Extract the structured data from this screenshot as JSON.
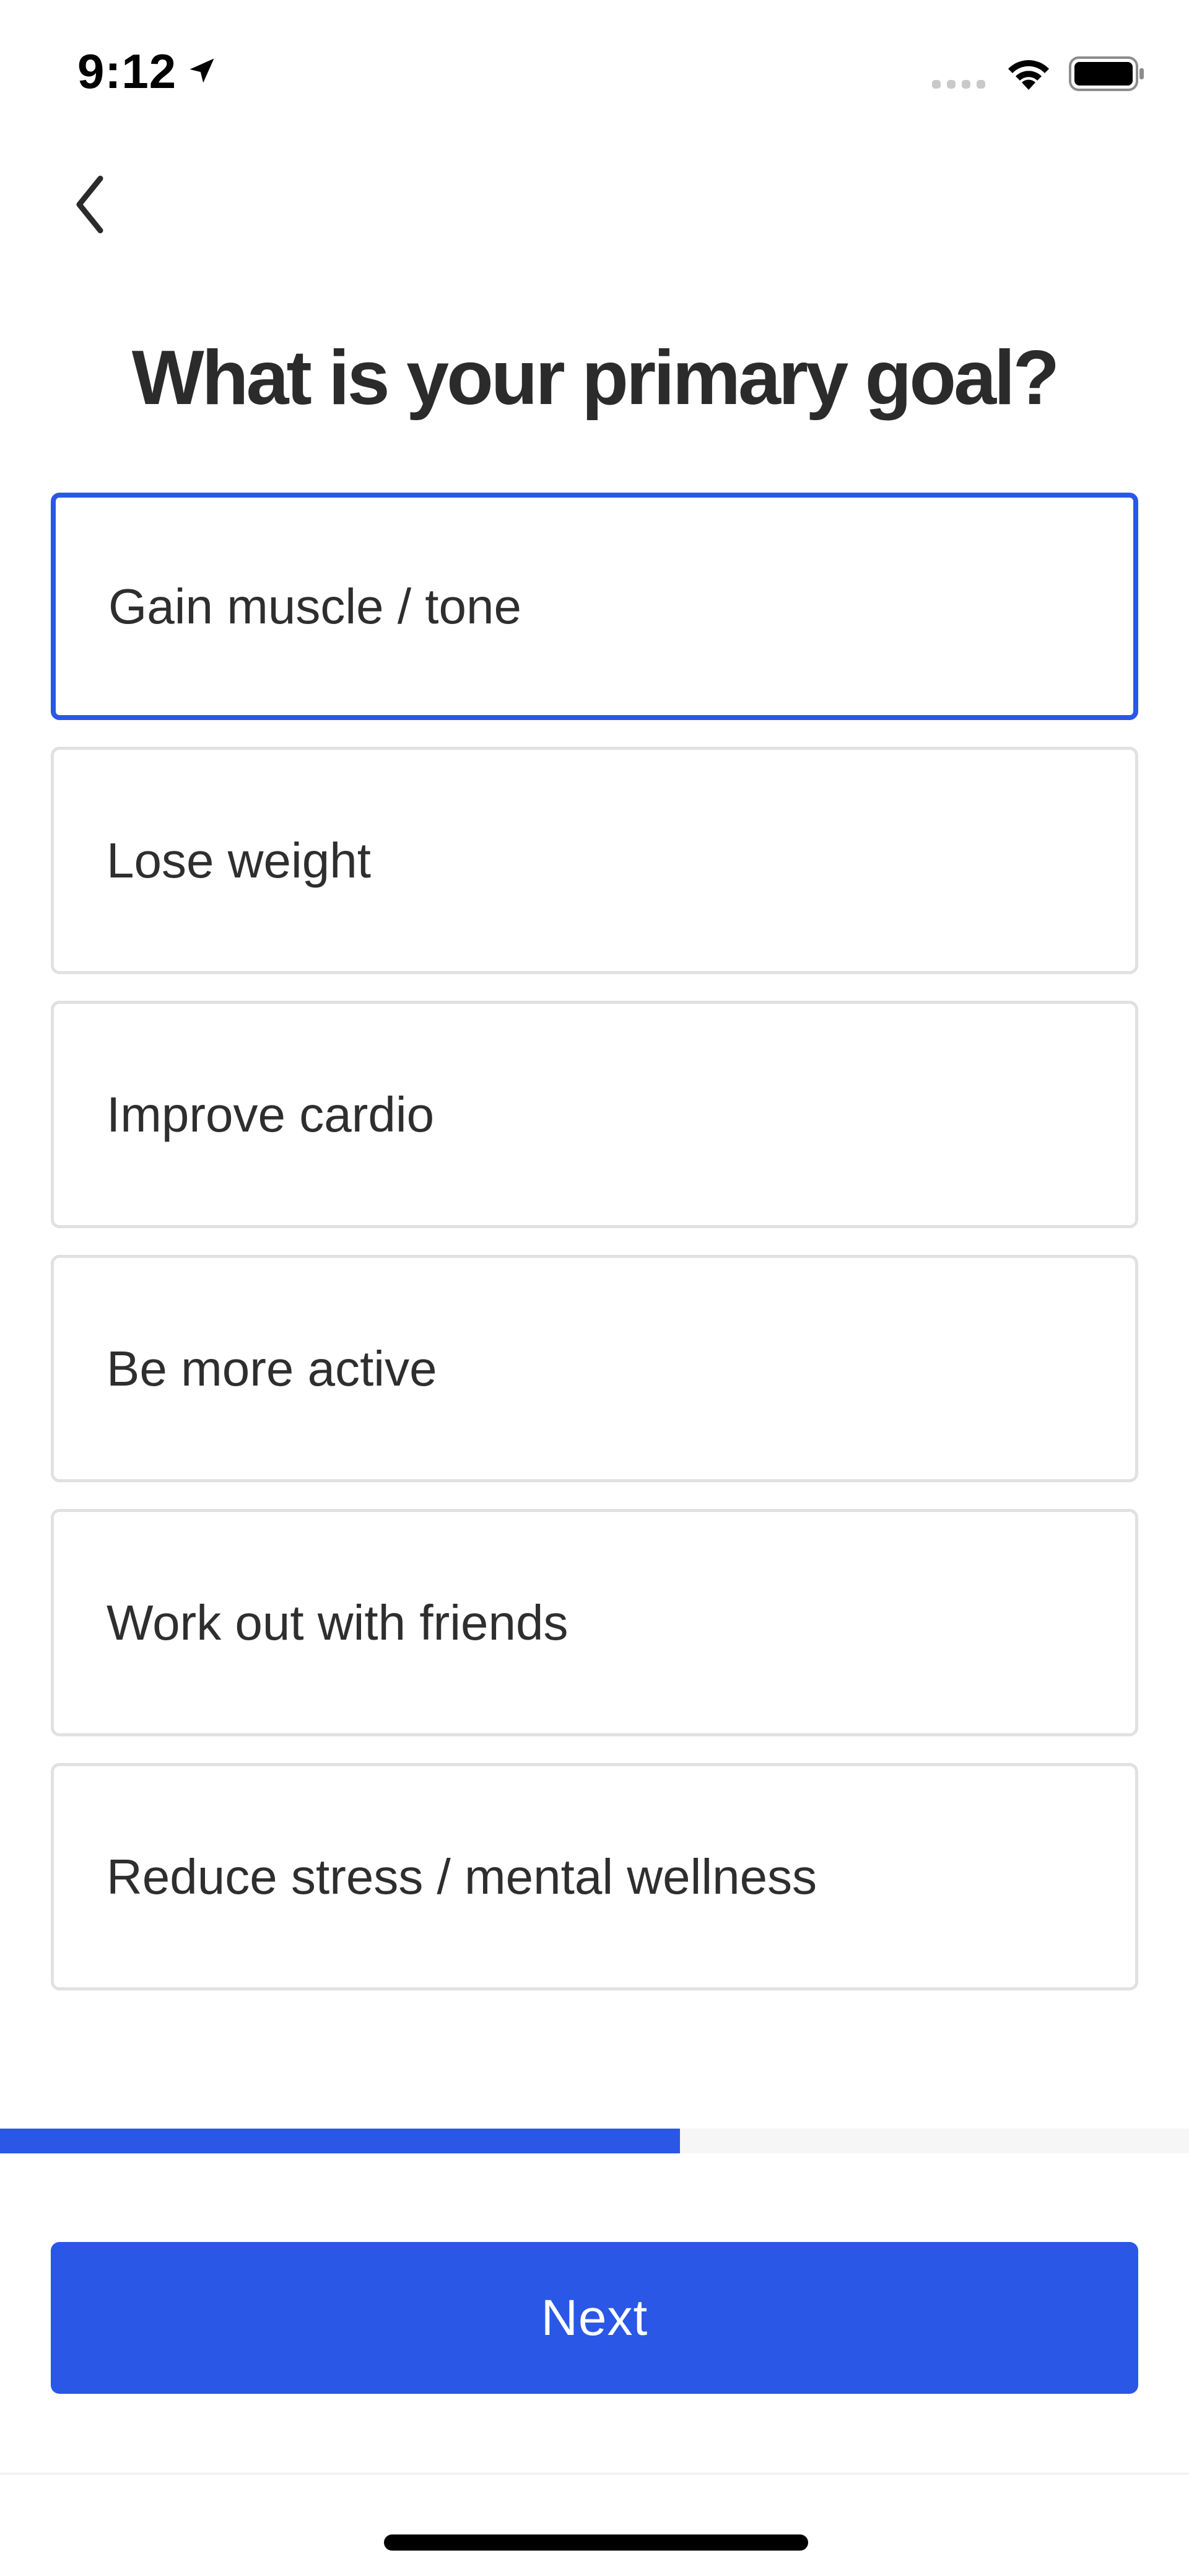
{
  "status_bar": {
    "time": "9:12",
    "icons": [
      "location-arrow-icon",
      "signal-icon",
      "wifi-icon",
      "battery-icon"
    ]
  },
  "navigation": {
    "back_icon": "chevron-left-icon"
  },
  "title": "What is your primary goal?",
  "options": [
    {
      "label": "Gain muscle / tone",
      "selected": true
    },
    {
      "label": "Lose weight",
      "selected": false
    },
    {
      "label": "Improve cardio",
      "selected": false
    },
    {
      "label": "Be more active",
      "selected": false
    },
    {
      "label": "Work out with friends",
      "selected": false
    },
    {
      "label": "Reduce stress / mental wellness",
      "selected": false
    }
  ],
  "progress": {
    "fraction": 0.572
  },
  "next_button": {
    "label": "Next"
  },
  "colors": {
    "accent": "#2a57e6",
    "text": "#2b2b2b",
    "border": "#e1e1e1",
    "background": "#ffffff"
  }
}
